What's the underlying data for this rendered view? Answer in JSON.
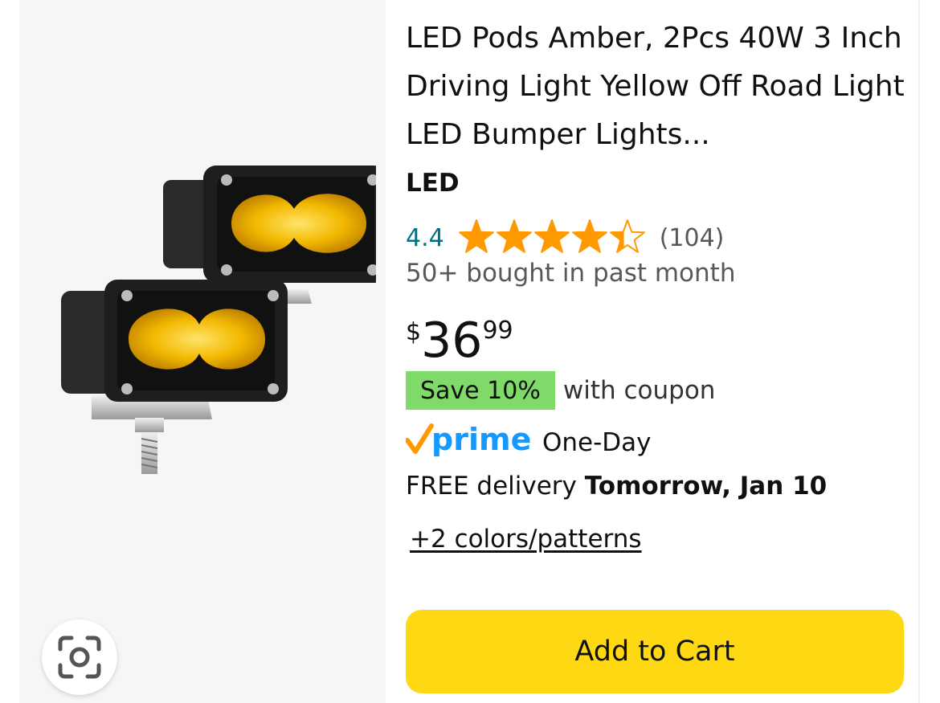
{
  "product": {
    "title": "LED Pods Amber, 2Pcs 40W 3 Inch Driving Light Yellow Off Road Light LED Bumper Lights...",
    "brand": "LED",
    "rating": {
      "value_text": "4.4",
      "value": 4.4,
      "max": 5,
      "count_text": "(104)"
    },
    "bought_text": "50+ bought in past month",
    "price": {
      "symbol": "$",
      "whole": "36",
      "fraction": "99"
    },
    "coupon": {
      "badge": "Save 10%",
      "text": "with coupon"
    },
    "prime": {
      "logo_text": "prime",
      "tier": "One-Day"
    },
    "delivery": {
      "prefix": "FREE delivery",
      "date": "Tomorrow, Jan 10"
    },
    "variants_link": "+2 colors/patterns",
    "add_to_cart": "Add to Cart"
  },
  "icons": {
    "lens": "camera-lens-icon",
    "stars": "star-icon",
    "prime_check": "prime-check-icon"
  },
  "colors": {
    "star": "#ff9900",
    "rating_link": "#007185",
    "coupon_badge": "#7fda69",
    "prime_blue": "#1399ff",
    "prime_check": "#ff9900",
    "cart_button": "#ffd814",
    "image_bg": "#f6f6f6"
  }
}
